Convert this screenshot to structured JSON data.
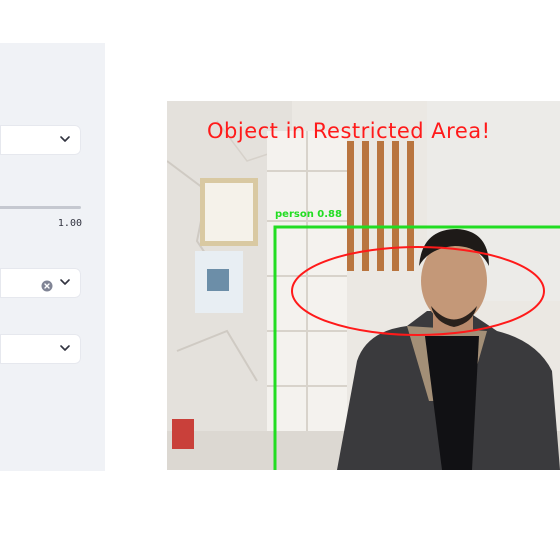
{
  "sidebar": {
    "select_1": {
      "value": ""
    },
    "slider": {
      "max_label": "1.00"
    },
    "multiselect": {
      "value": ""
    },
    "select_2": {
      "value": ""
    }
  },
  "video_feed": {
    "alert_text": "Object in Restricted Area!",
    "detection_label": "person 0.88",
    "colors": {
      "alert": "#ff1a1a",
      "box": "#22dd22",
      "zone": "#ff1a1a"
    }
  }
}
